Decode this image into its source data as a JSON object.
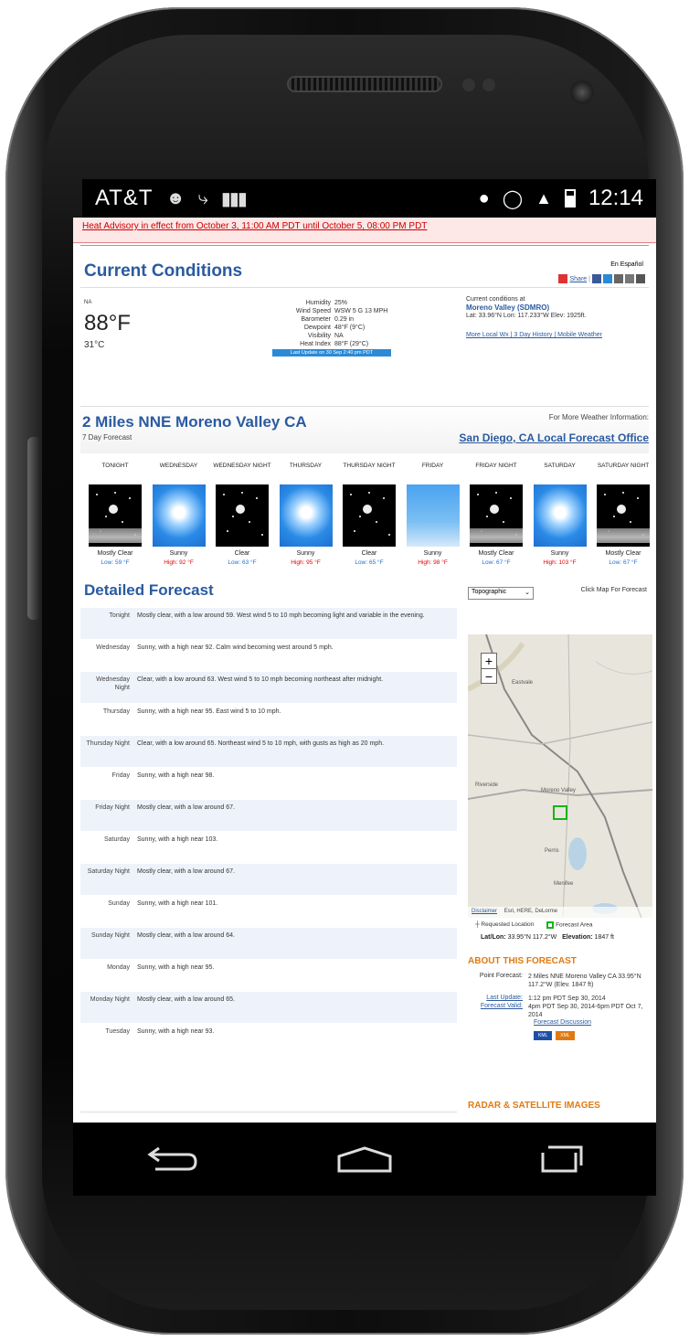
{
  "status_bar": {
    "carrier": "AT&T",
    "time": "12:14"
  },
  "advisory": "Heat Advisory in effect from October 3, 11:00 AM PDT until October 5, 08:00 PM PDT",
  "current_conditions": {
    "heading": "Current Conditions",
    "en_espanol": "En Español",
    "share": "Share",
    "na": "NA",
    "temp_f": "88°F",
    "temp_c": "31°C",
    "details": [
      {
        "label": "Humidity",
        "value": "25%"
      },
      {
        "label": "Wind Speed",
        "value": "WSW 5 G 13 MPH"
      },
      {
        "label": "Barometer",
        "value": "0.29 in"
      },
      {
        "label": "Dewpoint",
        "value": "48°F (9°C)"
      },
      {
        "label": "Visibility",
        "value": "NA"
      },
      {
        "label": "Heat Index",
        "value": "88°F (29°C)"
      }
    ],
    "last_update": "Last Update on 30 Sep 2:40 pm PDT",
    "station_label": "Current conditions at",
    "station_name": "Moreno Valley (SDMRO)",
    "station_coords": "Lat: 33.96°N Lon: 117.233°W Elev: 1925ft.",
    "links": "More Local Wx | 3 Day History | Mobile Weather"
  },
  "location": {
    "title": "2 Miles NNE Moreno Valley CA",
    "subtitle": "7 Day Forecast",
    "more_info": "For More Weather Information:",
    "office": "San Diego, CA Local Forecast Office"
  },
  "forecast": [
    {
      "period": "TONIGHT",
      "desc": "Mostly Clear",
      "temp": "Low: 59 °F",
      "kind": "lo",
      "img": "night-cloud"
    },
    {
      "period": "WEDNESDAY",
      "desc": "Sunny",
      "temp": "High: 92 °F",
      "kind": "hi",
      "img": "sunny"
    },
    {
      "period": "WEDNESDAY NIGHT",
      "desc": "Clear",
      "temp": "Low: 63 °F",
      "kind": "lo",
      "img": "night"
    },
    {
      "period": "THURSDAY",
      "desc": "Sunny",
      "temp": "High: 95 °F",
      "kind": "hi",
      "img": "sunny"
    },
    {
      "period": "THURSDAY NIGHT",
      "desc": "Clear",
      "temp": "Low: 65 °F",
      "kind": "lo",
      "img": "night"
    },
    {
      "period": "FRIDAY",
      "desc": "Sunny",
      "temp": "High: 98 °F",
      "kind": "hi",
      "img": "partly"
    },
    {
      "period": "FRIDAY NIGHT",
      "desc": "Mostly Clear",
      "temp": "Low: 67 °F",
      "kind": "lo",
      "img": "night-cloud"
    },
    {
      "period": "SATURDAY",
      "desc": "Sunny",
      "temp": "High: 103 °F",
      "kind": "hi",
      "img": "sunny"
    },
    {
      "period": "SATURDAY NIGHT",
      "desc": "Mostly Clear",
      "temp": "Low: 67 °F",
      "kind": "lo",
      "img": "night-cloud"
    }
  ],
  "detailed": {
    "heading": "Detailed Forecast",
    "rows": [
      {
        "name": "Tonight",
        "text": "Mostly clear, with a low around 59. West wind 5 to 10 mph becoming light and variable in the evening."
      },
      {
        "name": "Wednesday",
        "text": "Sunny, with a high near 92. Calm wind becoming west around 5 mph."
      },
      {
        "name": "Wednesday Night",
        "text": "Clear, with a low around 63. West wind 5 to 10 mph becoming northeast after midnight."
      },
      {
        "name": "Thursday",
        "text": "Sunny, with a high near 95. East wind 5 to 10 mph."
      },
      {
        "name": "Thursday Night",
        "text": "Clear, with a low around 65. Northeast wind 5 to 10 mph, with gusts as high as 20 mph."
      },
      {
        "name": "Friday",
        "text": "Sunny, with a high near 98."
      },
      {
        "name": "Friday Night",
        "text": "Mostly clear, with a low around 67."
      },
      {
        "name": "Saturday",
        "text": "Sunny, with a high near 103."
      },
      {
        "name": "Saturday Night",
        "text": "Mostly clear, with a low around 67."
      },
      {
        "name": "Sunday",
        "text": "Sunny, with a high near 101."
      },
      {
        "name": "Sunday Night",
        "text": "Mostly clear, with a low around 64."
      },
      {
        "name": "Monday",
        "text": "Sunny, with a high near 95."
      },
      {
        "name": "Monday Night",
        "text": "Mostly clear, with a low around 65."
      },
      {
        "name": "Tuesday",
        "text": "Sunny, with a high near 93."
      }
    ]
  },
  "map": {
    "select": "Topographic",
    "click_hint": "Click Map For Forecast",
    "disclaimer": "Disclaimer",
    "credit": "Esri, HERE, DeLorme",
    "legend_requested": "Requested Location",
    "legend_area": "Forecast Area",
    "latlon_label": "Lat/Lon:",
    "latlon_value": "33.95°N 117.2°W",
    "elev_label": "Elevation:",
    "elev_value": "1847 ft",
    "places": [
      "Eastvale",
      "Riverside",
      "Moreno Valley",
      "Perris",
      "Menifee"
    ]
  },
  "about": {
    "heading": "ABOUT THIS FORECAST",
    "point_label": "Point Forecast:",
    "point_value": "2 Miles NNE Moreno Valley CA 33.95°N 117.2°W (Elev. 1847 ft)",
    "last_update_label": "Last Update:",
    "last_update_value": "1:12 pm PDT Sep 30, 2014",
    "valid_label": "Forecast Valid:",
    "valid_value": "4pm PDT Sep 30, 2014-6pm PDT Oct 7, 2014",
    "discussion": "Forecast Discussion",
    "kml": "KML",
    "xml": "XML"
  },
  "radar_heading": "RADAR & SATELLITE IMAGES"
}
